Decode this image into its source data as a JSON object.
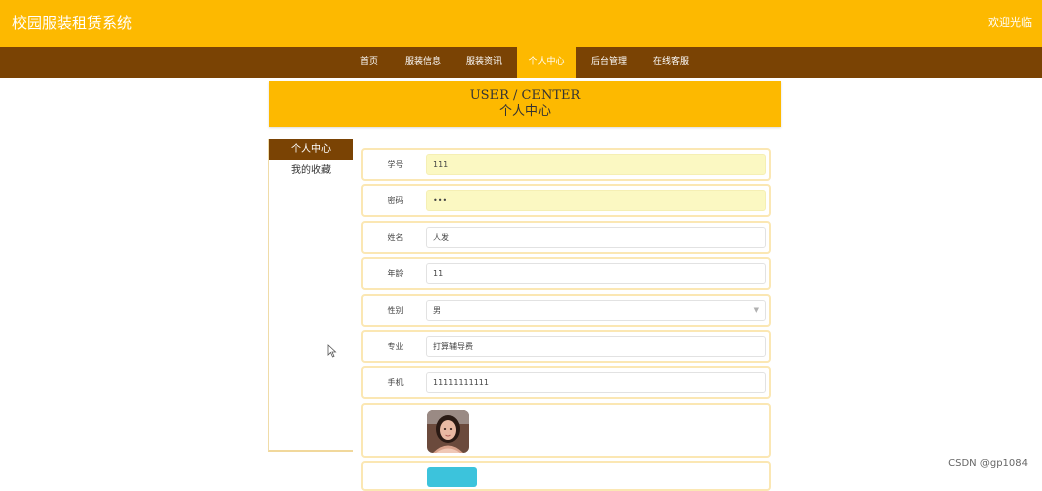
{
  "header": {
    "title": "校园服装租赁系统",
    "welcome": "欢迎光临"
  },
  "nav": {
    "items": [
      "首页",
      "服装信息",
      "服装资讯",
      "个人中心",
      "后台管理",
      "在线客服"
    ],
    "active_index": 3
  },
  "banner": {
    "title_en": "USER / CENTER",
    "title_zh": "个人中心"
  },
  "sidebar": {
    "items": [
      "个人中心",
      "我的收藏"
    ],
    "active_index": 0
  },
  "form": {
    "fields": [
      {
        "label": "学号",
        "value": "111",
        "type": "text",
        "filled": true
      },
      {
        "label": "密码",
        "value": "•••",
        "type": "password",
        "filled": true
      },
      {
        "label": "姓名",
        "value": "人发",
        "type": "text",
        "filled": false
      },
      {
        "label": "年龄",
        "value": "11",
        "type": "text",
        "filled": false
      },
      {
        "label": "性别",
        "value": "男",
        "type": "select",
        "filled": false
      },
      {
        "label": "专业",
        "value": "打算辅导费",
        "type": "text",
        "filled": false
      },
      {
        "label": "手机",
        "value": "11111111111",
        "type": "text",
        "filled": false
      }
    ]
  },
  "watermark": "CSDN @gp1084",
  "colors": {
    "primary": "#fdb900",
    "secondary": "#7a4304",
    "upload_button": "#3cc3dc"
  }
}
